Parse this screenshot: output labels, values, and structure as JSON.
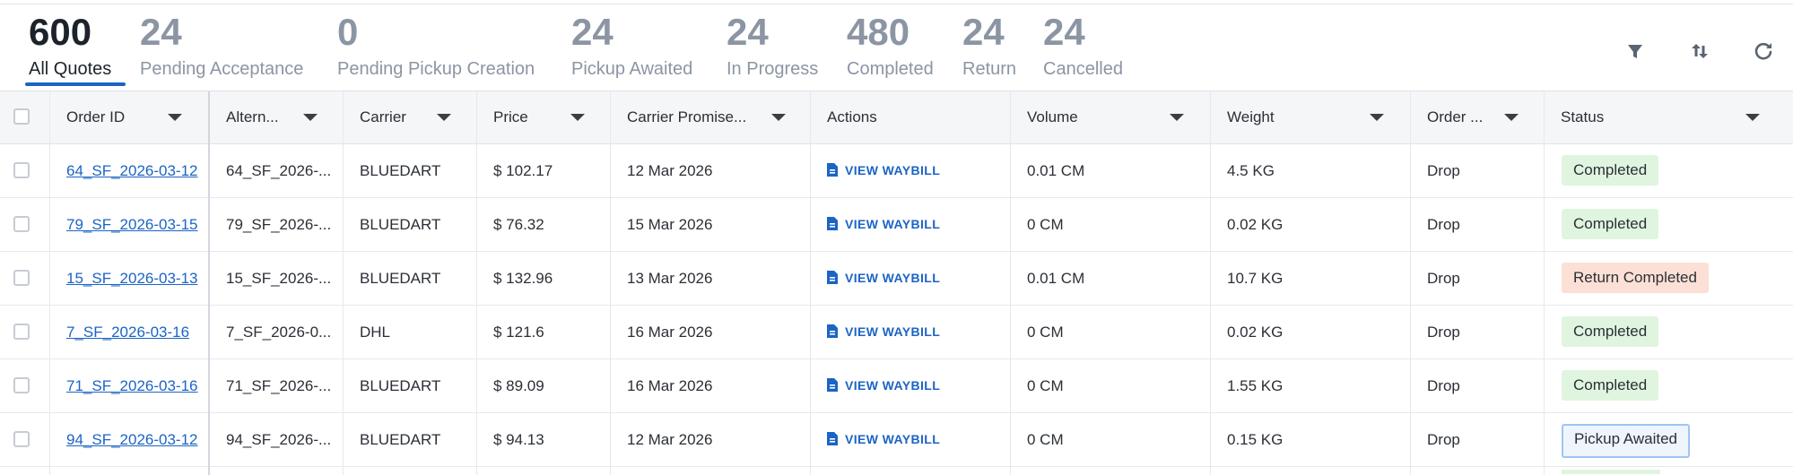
{
  "tabs": [
    {
      "count": "600",
      "label": "All Quotes",
      "active": true
    },
    {
      "count": "24",
      "label": "Pending Acceptance"
    },
    {
      "count": "0",
      "label": "Pending Pickup Creation"
    },
    {
      "count": "24",
      "label": "Pickup Awaited"
    },
    {
      "count": "24",
      "label": "In Progress"
    },
    {
      "count": "480",
      "label": "Completed"
    },
    {
      "count": "24",
      "label": "Return"
    },
    {
      "count": "24",
      "label": "Cancelled"
    }
  ],
  "toolbar": {
    "icons": [
      "filter-icon",
      "sort-icon",
      "refresh-icon"
    ]
  },
  "table": {
    "columns": [
      "Order ID",
      "Altern...",
      "Carrier",
      "Price",
      "Carrier Promise...",
      "Actions",
      "Volume",
      "Weight",
      "Order ...",
      "Status"
    ],
    "action_label": "VIEW WAYBILL",
    "rows": [
      {
        "order_id": "64_SF_2026-03-12",
        "alt": "64_SF_2026-...",
        "carrier": "BLUEDART",
        "price": "$ 102.17",
        "promise": "12 Mar 2026",
        "volume": "0.01 CM",
        "weight": "4.5 KG",
        "order_type": "Drop",
        "status": "Completed",
        "status_kind": "green"
      },
      {
        "order_id": "79_SF_2026-03-15",
        "alt": "79_SF_2026-...",
        "carrier": "BLUEDART",
        "price": "$ 76.32",
        "promise": "15 Mar 2026",
        "volume": "0 CM",
        "weight": "0.02 KG",
        "order_type": "Drop",
        "status": "Completed",
        "status_kind": "green"
      },
      {
        "order_id": "15_SF_2026-03-13",
        "alt": "15_SF_2026-...",
        "carrier": "BLUEDART",
        "price": "$ 132.96",
        "promise": "13 Mar 2026",
        "volume": "0.01 CM",
        "weight": "10.7 KG",
        "order_type": "Drop",
        "status": "Return Completed",
        "status_kind": "orange"
      },
      {
        "order_id": "7_SF_2026-03-16",
        "alt": "7_SF_2026-0...",
        "carrier": "DHL",
        "price": "$ 121.6",
        "promise": "16 Mar 2026",
        "volume": "0 CM",
        "weight": "0.02 KG",
        "order_type": "Drop",
        "status": "Completed",
        "status_kind": "green"
      },
      {
        "order_id": "71_SF_2026-03-16",
        "alt": "71_SF_2026-...",
        "carrier": "BLUEDART",
        "price": "$ 89.09",
        "promise": "16 Mar 2026",
        "volume": "0 CM",
        "weight": "1.55 KG",
        "order_type": "Drop",
        "status": "Completed",
        "status_kind": "green"
      },
      {
        "order_id": "94_SF_2026-03-12",
        "alt": "94_SF_2026-...",
        "carrier": "BLUEDART",
        "price": "$ 94.13",
        "promise": "12 Mar 2026",
        "volume": "0 CM",
        "weight": "0.15 KG",
        "order_type": "Drop",
        "status": "Pickup Awaited",
        "status_kind": "blue"
      }
    ]
  },
  "colors": {
    "accent": "#1c64c4",
    "status_green": "#e0f5df",
    "status_orange": "#fce0d6",
    "status_blue": "#eef5fd"
  }
}
